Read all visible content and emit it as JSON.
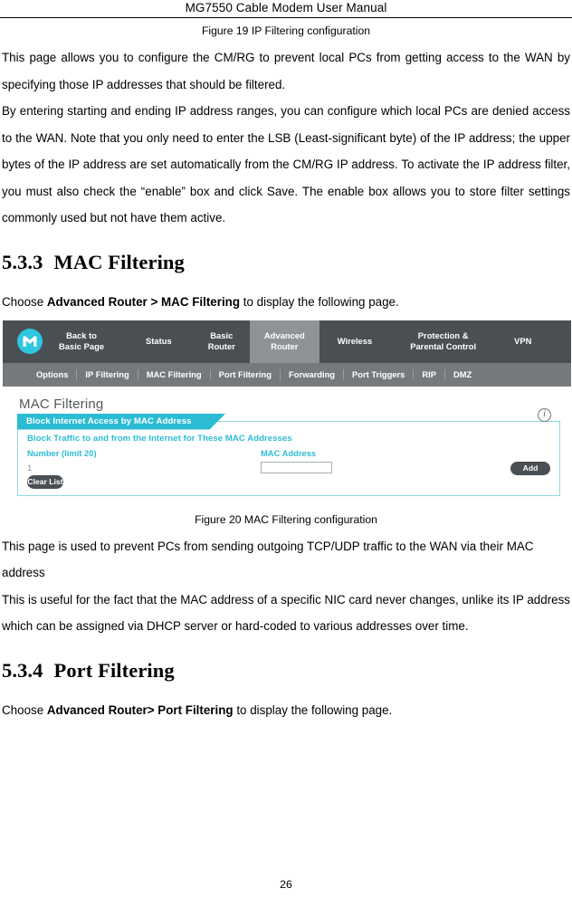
{
  "header": {
    "running_title": "MG7550 Cable Modem User Manual"
  },
  "figure19": {
    "caption": "Figure 19 IP Filtering configuration"
  },
  "paragraphs": {
    "ip_filtering_1": "This page allows you to configure the CM/RG to prevent local PCs from getting access to the WAN by specifying those IP addresses that should be filtered.",
    "ip_filtering_2": "By entering starting and ending IP address ranges, you can configure which local PCs are denied access to the WAN. Note that you only need to enter the LSB (Least-significant byte) of the IP address; the upper bytes of the IP address are set automatically from the CM/RG IP address. To activate the IP address filter, you must also check the “enable” box and click Save. The enable box allows you to store filter settings commonly used but not have them active.",
    "mac_filtering_1": "This page is used to prevent PCs from sending outgoing TCP/UDP traffic to the WAN via their MAC address",
    "mac_filtering_2": "This is useful for the fact that the MAC address of a specific NIC card never changes, unlike its IP address which can be assigned via DHCP server or hard-coded to various addresses over time."
  },
  "section_533": {
    "number": "5.3.3",
    "title": "MAC Filtering",
    "choose_prefix": "Choose ",
    "choose_path": "Advanced Router > MAC Filtering",
    "choose_suffix": " to display the following page."
  },
  "section_534": {
    "number": "5.3.4",
    "title": "Port Filtering",
    "choose_prefix": "Choose ",
    "choose_path": "Advanced Router> Port Filtering",
    "choose_suffix": " to display the following page."
  },
  "figure20": {
    "caption": "Figure 20 MAC Filtering configuration",
    "router_ui": {
      "logo": "motorola-batwing-logo",
      "primary_nav": [
        {
          "label": "Back to\nBasic Page",
          "active": false
        },
        {
          "label": "Status",
          "active": false
        },
        {
          "label": "Basic\nRouter",
          "active": false
        },
        {
          "label": "Advanced\nRouter",
          "active": true
        },
        {
          "label": "Wireless",
          "active": false
        },
        {
          "label": "Protection &\nParental Control",
          "active": false
        },
        {
          "label": "VPN",
          "active": false
        }
      ],
      "secondary_nav": [
        {
          "label": "Options",
          "active": false
        },
        {
          "label": "IP Filtering",
          "active": false
        },
        {
          "label": "MAC Filtering",
          "active": true
        },
        {
          "label": "Port Filtering",
          "active": false
        },
        {
          "label": "Forwarding",
          "active": false
        },
        {
          "label": "Port Triggers",
          "active": false
        },
        {
          "label": "RIP",
          "active": false
        },
        {
          "label": "DMZ",
          "active": false
        }
      ],
      "panel_title": "MAC Filtering",
      "banner_label": "Block Internet Access by MAC Address",
      "info_icon": "info-circle-icon",
      "info_icon_glyph": "i",
      "card_heading": "Block Traffic to and from the Internet for These MAC Addresses",
      "col_number_label": "Number (limit 20)",
      "col_mac_label": "MAC Address",
      "row_number_value": "1",
      "mac_input_value": "",
      "mac_input_placeholder": "",
      "add_button": "Add",
      "clear_list_button": "Clear List",
      "colors": {
        "nav_bg": "#4a4f53",
        "nav_active_bg": "#8e9396",
        "subnav_bg": "#76797c",
        "accent_teal": "#2bbcd4",
        "card_border": "#8fd8e4",
        "logo_cyan": "#2ec7df"
      }
    }
  },
  "footer": {
    "page_number": "26"
  }
}
